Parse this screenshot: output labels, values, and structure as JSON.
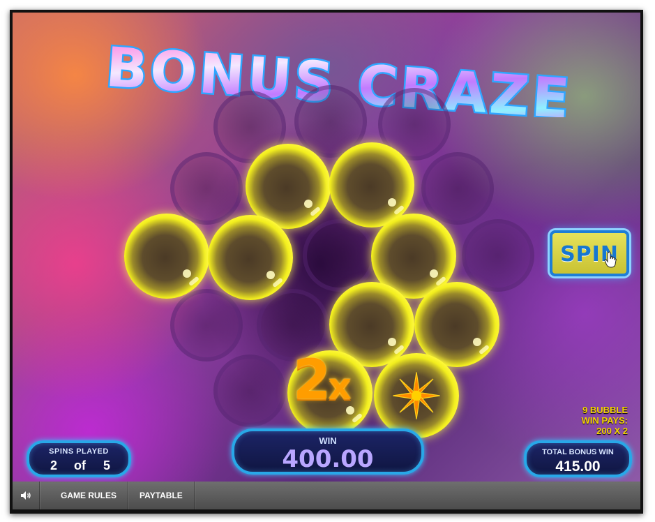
{
  "game": {
    "title": "BONUS CRAZE",
    "multiplier": {
      "value": "2",
      "symbol": "x"
    },
    "spin_label": "SPIN",
    "spins_played": {
      "caption": "SPINS PLAYED",
      "current": "2",
      "of_label": "of",
      "total": "5"
    },
    "win": {
      "caption": "WIN",
      "amount": "400.00"
    },
    "total_bonus_win": {
      "caption": "TOTAL BONUS WIN",
      "amount": "415.00"
    },
    "pays": {
      "line1": "9 BUBBLE",
      "line2": "WIN PAYS:",
      "line3": "200 X 2"
    },
    "bubbles_lit": 9,
    "colors": {
      "bubble": "#f1ee13",
      "multiplier": "#ff9d00",
      "panel_border": "#28a8e8",
      "spin_text": "#1677d0",
      "pays_text": "#f4d400"
    }
  },
  "toolbar": {
    "sound_icon": "speaker-icon",
    "game_rules_label": "GAME RULES",
    "paytable_label": "PAYTABLE"
  }
}
